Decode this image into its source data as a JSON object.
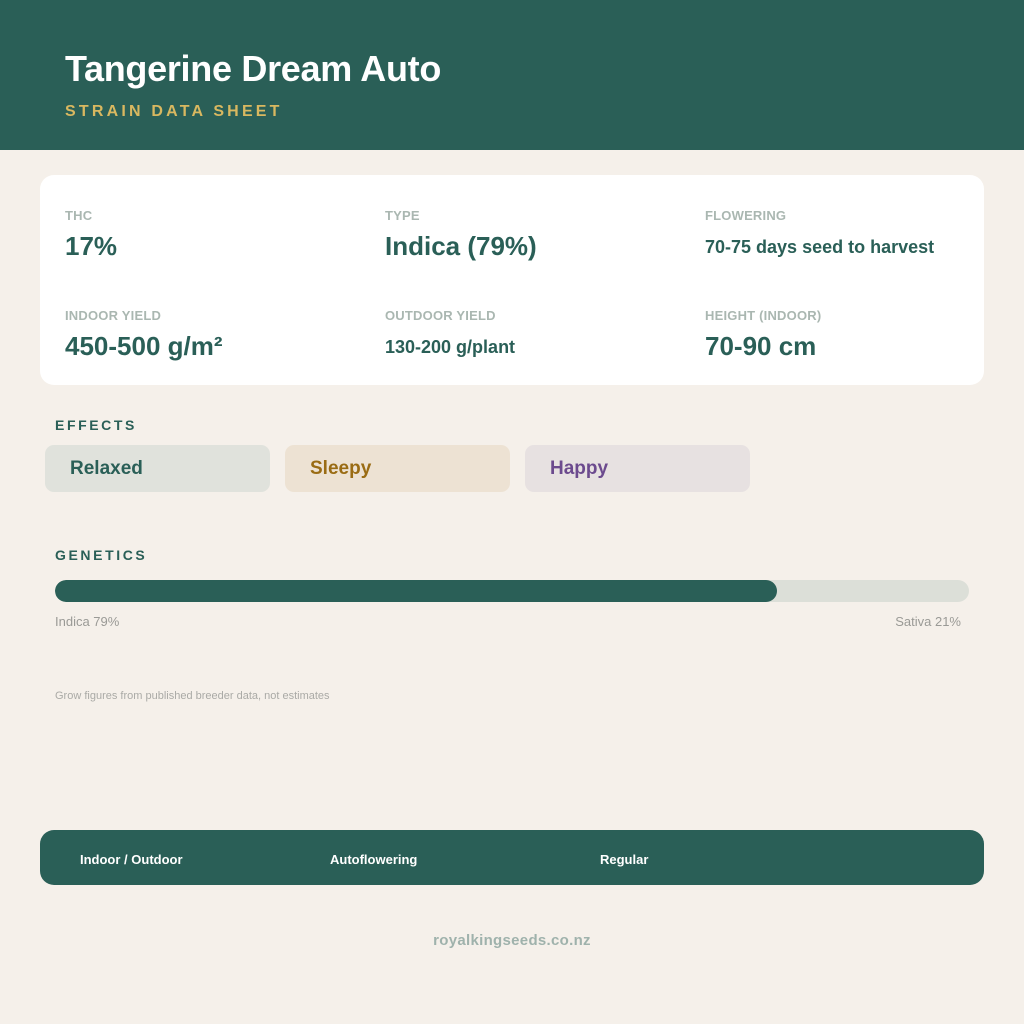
{
  "header": {
    "title": "Tangerine Dream Auto",
    "subtitle": "STRAIN DATA SHEET"
  },
  "stats": {
    "thc": {
      "label": "THC",
      "value": "17%"
    },
    "type": {
      "label": "TYPE",
      "value": "Indica (79%)"
    },
    "flowering": {
      "label": "FLOWERING",
      "value": "70-75 days seed to harvest"
    },
    "indoor_yield": {
      "label": "INDOOR YIELD",
      "value": "450-500 g/m²"
    },
    "outdoor_yield": {
      "label": "OUTDOOR YIELD",
      "value": "130-200 g/plant"
    },
    "height": {
      "label": "HEIGHT (INDOOR)",
      "value": "70-90 cm"
    }
  },
  "effects": {
    "heading": "EFFECTS",
    "items": [
      {
        "label": "Relaxed",
        "text_color": "#2a5f57",
        "bg_color": "#e0e2dc"
      },
      {
        "label": "Sleepy",
        "text_color": "#9a6c14",
        "bg_color": "#ede2d3"
      },
      {
        "label": "Happy",
        "text_color": "#6c4a8e",
        "bg_color": "#e7e1e1"
      }
    ]
  },
  "genetics": {
    "heading": "GENETICS",
    "indica_percent": 79,
    "sativa_percent": 21,
    "indica_caption": "Indica 79%",
    "sativa_caption": "Sativa 21%"
  },
  "note": "Grow figures from published breeder data, not estimates",
  "footer": {
    "items": [
      "Indoor / Outdoor",
      "Autoflowering",
      "Regular"
    ]
  },
  "website": "royalkingseeds.co.nz",
  "colors": {
    "brand_green": "#2a5f57",
    "accent_gold": "#d9b860",
    "background": "#f5f0ea"
  }
}
